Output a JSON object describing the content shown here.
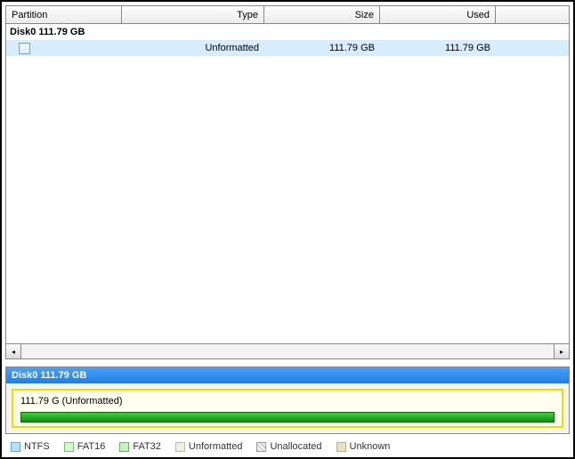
{
  "columns": {
    "partition": "Partition",
    "type": "Type",
    "size": "Size",
    "used": "Used"
  },
  "disk": {
    "label": "Disk0 111.79 GB"
  },
  "partition_row": {
    "type": "Unformatted",
    "size": "111.79 GB",
    "used": "111.79 GB"
  },
  "map": {
    "header": "Disk0   111.79 GB",
    "partition_label": "111.79 G  (Unformatted)"
  },
  "legend": {
    "ntfs": "NTFS",
    "fat16": "FAT16",
    "fat32": "FAT32",
    "unformatted": "Unformatted",
    "unallocated": "Unallocated",
    "unknown": "Unknown"
  }
}
